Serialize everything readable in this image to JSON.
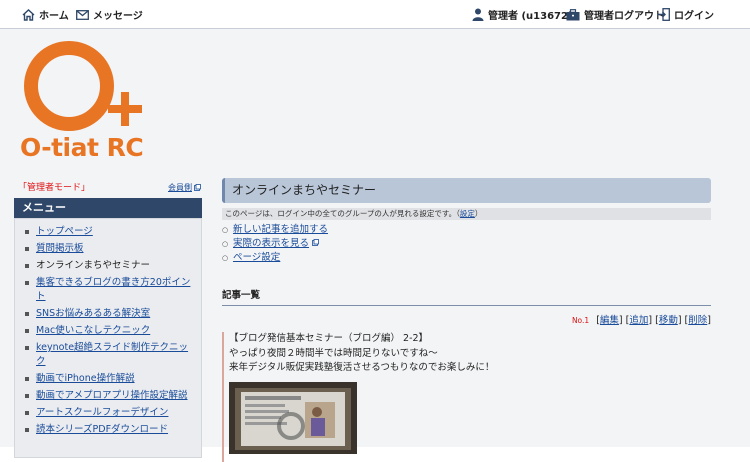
{
  "topbar": {
    "home": "ホーム",
    "message": "メッセージ",
    "admin_user": "管理者 (u13672)",
    "admin_logout": "管理者ログアウト",
    "login": "ログイン"
  },
  "logo": {
    "text": "O-tiat RC"
  },
  "sidebar": {
    "admin_mode": "「管理者モード」",
    "member_link": "会員側",
    "menu_title": "メニュー",
    "items": [
      {
        "label": "トップページ"
      },
      {
        "label": "質問掲示板"
      },
      {
        "label": "オンラインまちやセミナー"
      },
      {
        "label": "集客できるブログの書き方20ポイント"
      },
      {
        "label": "SNSお悩みあるある解決室"
      },
      {
        "label": "Mac使いこなしテクニック"
      },
      {
        "label": "keynote超絶スライド制作テクニック"
      },
      {
        "label": "動画でiPhone操作解説"
      },
      {
        "label": "動画でアメプロアプリ操作設定解説"
      },
      {
        "label": "アートスクールフォーデザイン"
      },
      {
        "label": "読本シリーズPDFダウンロード"
      }
    ]
  },
  "main": {
    "title": "オンラインまちやセミナー",
    "notice_text": "このページは、ログイン中の全てのグループの人が見れる設定です。（",
    "notice_link": "設定",
    "notice_end": "）",
    "actions": [
      {
        "label": "新しい記事を追加する"
      },
      {
        "label": "実際の表示を見る"
      },
      {
        "label": "ページ設定"
      }
    ],
    "list_heading": "記事一覧",
    "entry_no": "No.1",
    "tools": [
      "編集",
      "追加",
      "移動",
      "削除"
    ],
    "entry": {
      "title": "【ブログ発信基本セミナー（ブログ編） 2-2】",
      "line1": "やっぱり夜間２時間半では時間足りないですね〜",
      "line2": "来年デジタル販促実践塾復活させるつもりなのでお楽しみに！"
    }
  },
  "colors": {
    "brand_orange": "#e87524",
    "menu_header": "#2f4769",
    "link": "#1a4c9a",
    "alert_red": "#dd1111"
  }
}
